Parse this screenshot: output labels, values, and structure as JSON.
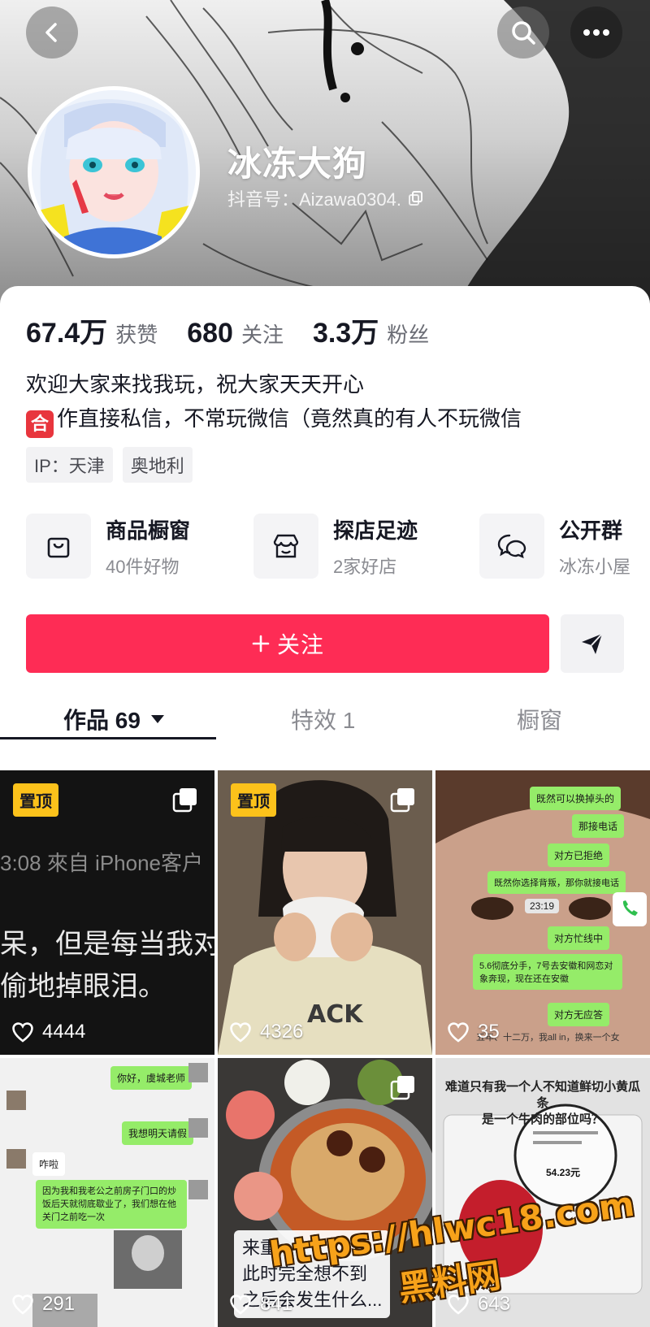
{
  "header": {
    "nickname": "冰冻大狗",
    "douyin_id": "抖音号：Aizawa0304.",
    "icons": [
      "back-icon",
      "search-icon",
      "more-icon",
      "copy-icon"
    ]
  },
  "stats": [
    {
      "value": "67.4万",
      "label": "获赞"
    },
    {
      "value": "680",
      "label": "关注"
    },
    {
      "value": "3.3万",
      "label": "粉丝"
    }
  ],
  "bio": {
    "line1": "欢迎大家来找我玩，祝大家天天开心",
    "badge": "合",
    "line2": "作直接私信，不常玩微信（竟然真的有人不玩微信"
  },
  "tags": [
    "IP：天津",
    "奥地利"
  ],
  "services": [
    {
      "title": "商品橱窗",
      "sub": "40件好物",
      "icon": "shopping-bag-icon"
    },
    {
      "title": "探店足迹",
      "sub": "2家好店",
      "icon": "store-icon"
    },
    {
      "title": "公开群",
      "sub": "冰冻小屋",
      "icon": "chat-bubbles-icon"
    }
  ],
  "actions": {
    "follow": "关注",
    "message_icon": "send-icon"
  },
  "tabs": [
    {
      "label": "作品 69",
      "active": true
    },
    {
      "label": "特效 1",
      "active": false
    },
    {
      "label": "橱窗",
      "active": false
    }
  ],
  "videos": [
    {
      "pinned": "置顶",
      "likes": "4444",
      "text1": "3:08  來自 iPhone客户",
      "text2": "呆，但是每当我对",
      "text3": "偷地掉眼泪。"
    },
    {
      "pinned": "置顶",
      "likes": "4326"
    },
    {
      "likes": "35",
      "chats": [
        "既然可以换掉头的",
        "那接电话",
        "对方已拒绝",
        "既然你选择背叛，那你就接电话",
        "23:19",
        "对方忙线中",
        "5.6彻底分手，7号去安徽和网恋对象奔现，现在还在安徽",
        "对方无应答",
        "五年、十二万，我all in，换来一个女"
      ]
    },
    {
      "likes": "291",
      "chats": [
        "你好，虞城老师",
        "我想明天请假",
        "咋啦",
        "因为我和我老公之前房子门口的炒饭后天就彻底歇业了，我们想在他关门之前吃一次"
      ]
    },
    {
      "likes": "841",
      "caption1": "来重",
      "caption2": "此时完全想不到",
      "caption3": "之后会发生什么..."
    },
    {
      "likes": "643",
      "caption1": "难道只有我一个人不知道鲜切小黄瓜条",
      "caption2": "是一个牛肉的部位吗？",
      "price": "54.23元"
    }
  ],
  "watermark": {
    "line1": "https://hlwc18.com",
    "line2": "黑料网"
  },
  "colors": {
    "accent": "#fe2c55",
    "pin": "#fcc21b",
    "text": "#161823",
    "muted": "#8a8b91"
  }
}
